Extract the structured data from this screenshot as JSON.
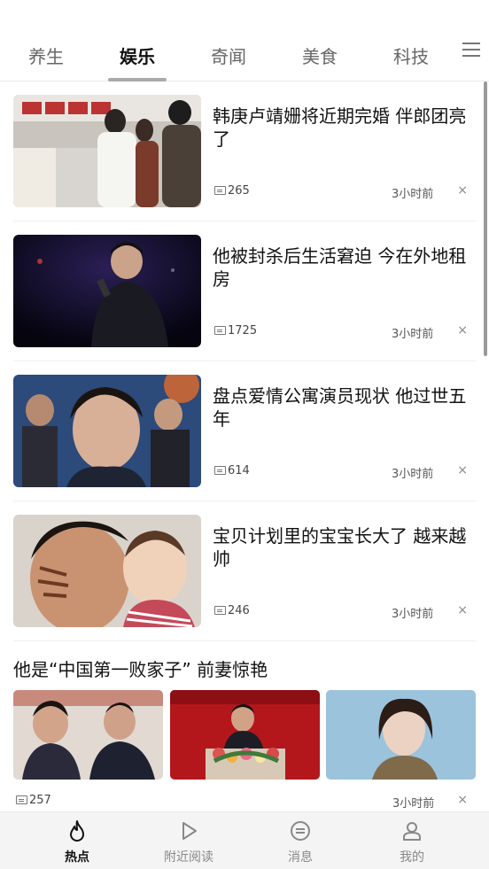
{
  "tabs": [
    {
      "label": "养生"
    },
    {
      "label": "娱乐"
    },
    {
      "label": "奇闻"
    },
    {
      "label": "美食"
    },
    {
      "label": "科技"
    }
  ],
  "feed": {
    "items": [
      {
        "title": "韩庚卢靖姗将近期完婚 伴郎团亮了",
        "comments": "265",
        "time": "3小时前",
        "close": "×"
      },
      {
        "title": "他被封杀后生活窘迫 今在外地租房",
        "comments": "1725",
        "time": "3小时前",
        "close": "×"
      },
      {
        "title": "盘点爱情公寓演员现状 他过世五年",
        "comments": "614",
        "time": "3小时前",
        "close": "×"
      },
      {
        "title": "宝贝计划里的宝宝长大了 越来越帅",
        "comments": "246",
        "time": "3小时前",
        "close": "×"
      }
    ],
    "gallery": {
      "title": "他是“中国第一败家子” 前妻惊艳",
      "comments": "257",
      "time": "3小时前",
      "close": "×"
    }
  },
  "bottom_nav": [
    {
      "label": "热点",
      "icon": "flame-icon"
    },
    {
      "label": "附近阅读",
      "icon": "play-icon"
    },
    {
      "label": "消息",
      "icon": "message-icon"
    },
    {
      "label": "我的",
      "icon": "user-icon"
    }
  ]
}
